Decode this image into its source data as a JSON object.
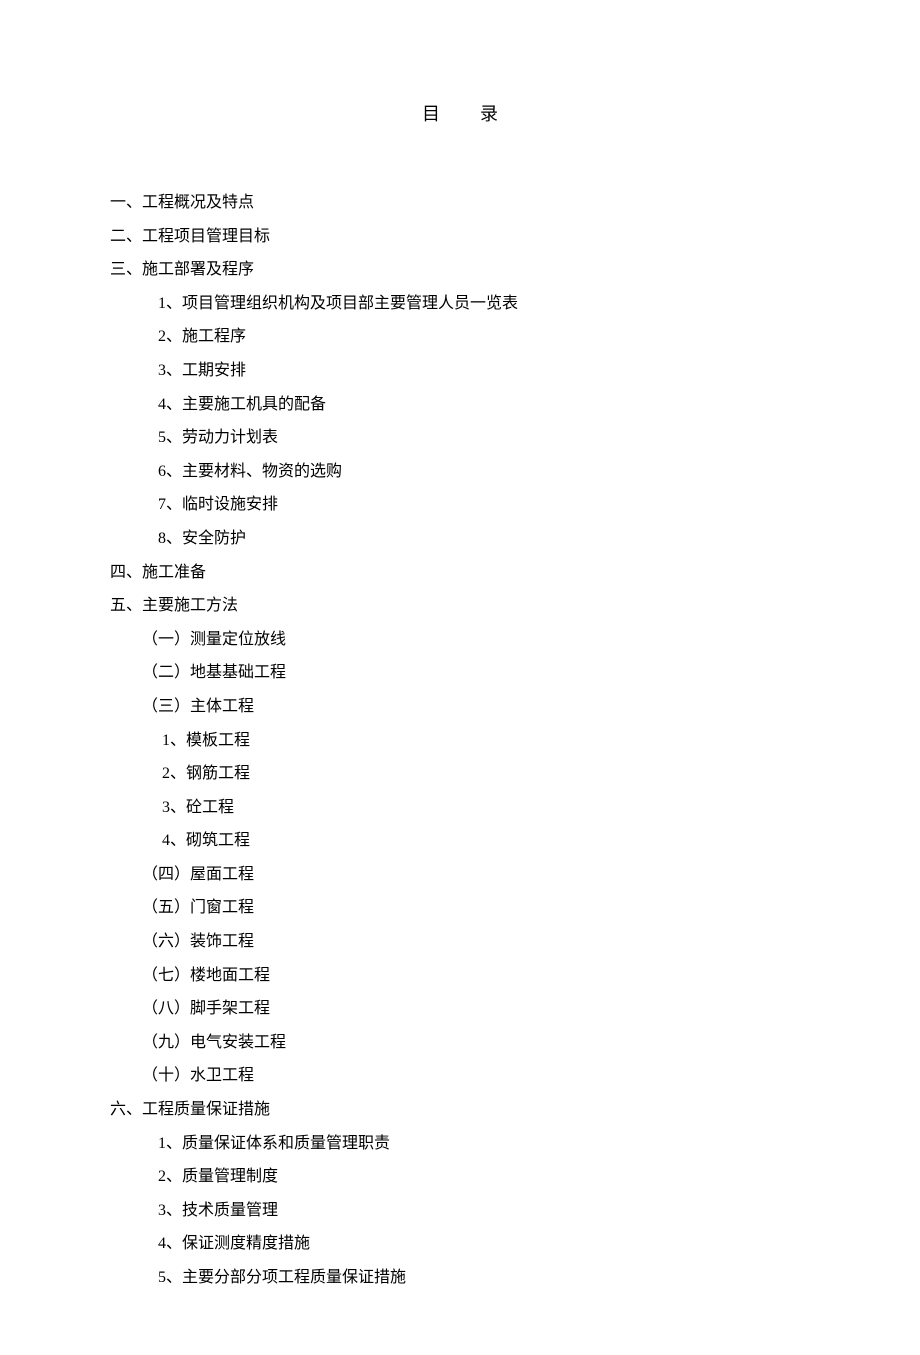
{
  "title": "目录",
  "toc": {
    "section1": "一、工程概况及特点",
    "section2": "二、工程项目管理目标",
    "section3": "三、施工部署及程序",
    "section3_1": "1、项目管理组织机构及项目部主要管理人员一览表",
    "section3_2": "2、施工程序",
    "section3_3": "3、工期安排",
    "section3_4": "4、主要施工机具的配备",
    "section3_5": "5、劳动力计划表",
    "section3_6": "6、主要材料、物资的选购",
    "section3_7": "7、临时设施安排",
    "section3_8": "8、安全防护",
    "section4": "四、施工准备",
    "section5": "五、主要施工方法",
    "section5_p1": "（一）测量定位放线",
    "section5_p2": "（二）地基基础工程",
    "section5_p3": "（三）主体工程",
    "section5_p3_1": "1、模板工程",
    "section5_p3_2": "2、钢筋工程",
    "section5_p3_3": "3、砼工程",
    "section5_p3_4": "4、砌筑工程",
    "section5_p4": "（四）屋面工程",
    "section5_p5": "（五）门窗工程",
    "section5_p6": "（六）装饰工程",
    "section5_p7": "（七）楼地面工程",
    "section5_p8": "（八）脚手架工程",
    "section5_p9": "（九）电气安装工程",
    "section5_p10": "（十）水卫工程",
    "section6": "六、工程质量保证措施",
    "section6_1": "1、质量保证体系和质量管理职责",
    "section6_2": "2、质量管理制度",
    "section6_3": "3、技术质量管理",
    "section6_4": "4、保证测度精度措施",
    "section6_5": "5、主要分部分项工程质量保证措施"
  }
}
